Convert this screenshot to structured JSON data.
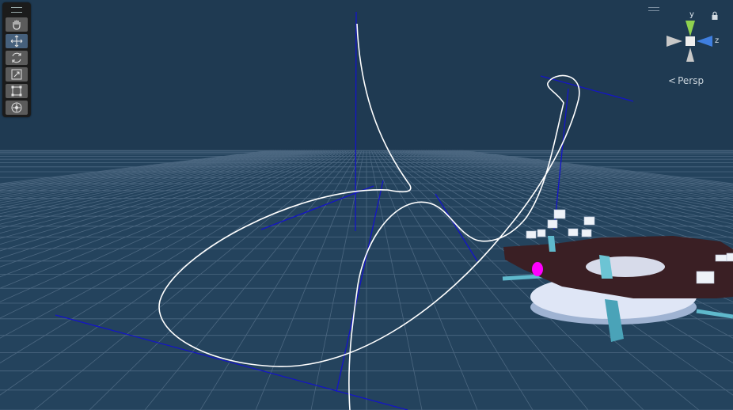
{
  "toolbar": {
    "tools": [
      {
        "name": "hand-tool",
        "icon": "hand-icon",
        "active": false
      },
      {
        "name": "move-tool",
        "icon": "move-icon",
        "active": true
      },
      {
        "name": "rotate-tool",
        "icon": "rotate-icon",
        "active": false
      },
      {
        "name": "scale-tool",
        "icon": "scale-icon",
        "active": false
      },
      {
        "name": "rect-tool",
        "icon": "rect-transform-icon",
        "active": false
      },
      {
        "name": "transform-tool",
        "icon": "transform-icon",
        "active": false
      }
    ]
  },
  "gizmo": {
    "y_label": "y",
    "z_label": "z",
    "projection_label": "Persp",
    "colors": {
      "y": "#8fd14f",
      "z": "#3f7fe0",
      "neutral": "#c8c8c8"
    }
  },
  "colors": {
    "background": "#1f3a52",
    "grid": "#4f6a82",
    "spline": "#ffffff",
    "tangent": "#1414c8",
    "platform": "#3a1f24",
    "post": "#5fb9cc",
    "marker": "#ff00ff"
  }
}
